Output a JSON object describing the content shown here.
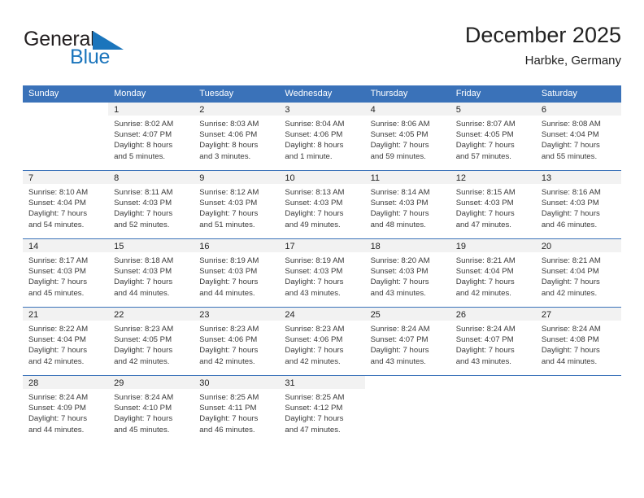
{
  "brand": {
    "word1": "General",
    "word2": "Blue",
    "triangle_icon": "blue-triangle-icon",
    "color_dark": "#231f20",
    "color_blue": "#1b75bc"
  },
  "header": {
    "title": "December 2025",
    "subtitle": "Harbke, Germany"
  },
  "theme": {
    "header_blue": "#3a72b9",
    "daynum_band": "#f2f2f2",
    "text": "#222222"
  },
  "weekdays": [
    "Sunday",
    "Monday",
    "Tuesday",
    "Wednesday",
    "Thursday",
    "Friday",
    "Saturday"
  ],
  "labels": {
    "sunrise": "Sunrise:",
    "sunset": "Sunset:",
    "daylight": "Daylight:"
  },
  "weeks": [
    [
      {
        "empty": true
      },
      {
        "day": "1",
        "l1": "Sunrise: 8:02 AM",
        "l2": "Sunset: 4:07 PM",
        "l3": "Daylight: 8 hours",
        "l4": "and 5 minutes."
      },
      {
        "day": "2",
        "l1": "Sunrise: 8:03 AM",
        "l2": "Sunset: 4:06 PM",
        "l3": "Daylight: 8 hours",
        "l4": "and 3 minutes."
      },
      {
        "day": "3",
        "l1": "Sunrise: 8:04 AM",
        "l2": "Sunset: 4:06 PM",
        "l3": "Daylight: 8 hours",
        "l4": "and 1 minute."
      },
      {
        "day": "4",
        "l1": "Sunrise: 8:06 AM",
        "l2": "Sunset: 4:05 PM",
        "l3": "Daylight: 7 hours",
        "l4": "and 59 minutes."
      },
      {
        "day": "5",
        "l1": "Sunrise: 8:07 AM",
        "l2": "Sunset: 4:05 PM",
        "l3": "Daylight: 7 hours",
        "l4": "and 57 minutes."
      },
      {
        "day": "6",
        "l1": "Sunrise: 8:08 AM",
        "l2": "Sunset: 4:04 PM",
        "l3": "Daylight: 7 hours",
        "l4": "and 55 minutes."
      }
    ],
    [
      {
        "day": "7",
        "l1": "Sunrise: 8:10 AM",
        "l2": "Sunset: 4:04 PM",
        "l3": "Daylight: 7 hours",
        "l4": "and 54 minutes."
      },
      {
        "day": "8",
        "l1": "Sunrise: 8:11 AM",
        "l2": "Sunset: 4:03 PM",
        "l3": "Daylight: 7 hours",
        "l4": "and 52 minutes."
      },
      {
        "day": "9",
        "l1": "Sunrise: 8:12 AM",
        "l2": "Sunset: 4:03 PM",
        "l3": "Daylight: 7 hours",
        "l4": "and 51 minutes."
      },
      {
        "day": "10",
        "l1": "Sunrise: 8:13 AM",
        "l2": "Sunset: 4:03 PM",
        "l3": "Daylight: 7 hours",
        "l4": "and 49 minutes."
      },
      {
        "day": "11",
        "l1": "Sunrise: 8:14 AM",
        "l2": "Sunset: 4:03 PM",
        "l3": "Daylight: 7 hours",
        "l4": "and 48 minutes."
      },
      {
        "day": "12",
        "l1": "Sunrise: 8:15 AM",
        "l2": "Sunset: 4:03 PM",
        "l3": "Daylight: 7 hours",
        "l4": "and 47 minutes."
      },
      {
        "day": "13",
        "l1": "Sunrise: 8:16 AM",
        "l2": "Sunset: 4:03 PM",
        "l3": "Daylight: 7 hours",
        "l4": "and 46 minutes."
      }
    ],
    [
      {
        "day": "14",
        "l1": "Sunrise: 8:17 AM",
        "l2": "Sunset: 4:03 PM",
        "l3": "Daylight: 7 hours",
        "l4": "and 45 minutes."
      },
      {
        "day": "15",
        "l1": "Sunrise: 8:18 AM",
        "l2": "Sunset: 4:03 PM",
        "l3": "Daylight: 7 hours",
        "l4": "and 44 minutes."
      },
      {
        "day": "16",
        "l1": "Sunrise: 8:19 AM",
        "l2": "Sunset: 4:03 PM",
        "l3": "Daylight: 7 hours",
        "l4": "and 44 minutes."
      },
      {
        "day": "17",
        "l1": "Sunrise: 8:19 AM",
        "l2": "Sunset: 4:03 PM",
        "l3": "Daylight: 7 hours",
        "l4": "and 43 minutes."
      },
      {
        "day": "18",
        "l1": "Sunrise: 8:20 AM",
        "l2": "Sunset: 4:03 PM",
        "l3": "Daylight: 7 hours",
        "l4": "and 43 minutes."
      },
      {
        "day": "19",
        "l1": "Sunrise: 8:21 AM",
        "l2": "Sunset: 4:04 PM",
        "l3": "Daylight: 7 hours",
        "l4": "and 42 minutes."
      },
      {
        "day": "20",
        "l1": "Sunrise: 8:21 AM",
        "l2": "Sunset: 4:04 PM",
        "l3": "Daylight: 7 hours",
        "l4": "and 42 minutes."
      }
    ],
    [
      {
        "day": "21",
        "l1": "Sunrise: 8:22 AM",
        "l2": "Sunset: 4:04 PM",
        "l3": "Daylight: 7 hours",
        "l4": "and 42 minutes."
      },
      {
        "day": "22",
        "l1": "Sunrise: 8:23 AM",
        "l2": "Sunset: 4:05 PM",
        "l3": "Daylight: 7 hours",
        "l4": "and 42 minutes."
      },
      {
        "day": "23",
        "l1": "Sunrise: 8:23 AM",
        "l2": "Sunset: 4:06 PM",
        "l3": "Daylight: 7 hours",
        "l4": "and 42 minutes."
      },
      {
        "day": "24",
        "l1": "Sunrise: 8:23 AM",
        "l2": "Sunset: 4:06 PM",
        "l3": "Daylight: 7 hours",
        "l4": "and 42 minutes."
      },
      {
        "day": "25",
        "l1": "Sunrise: 8:24 AM",
        "l2": "Sunset: 4:07 PM",
        "l3": "Daylight: 7 hours",
        "l4": "and 43 minutes."
      },
      {
        "day": "26",
        "l1": "Sunrise: 8:24 AM",
        "l2": "Sunset: 4:07 PM",
        "l3": "Daylight: 7 hours",
        "l4": "and 43 minutes."
      },
      {
        "day": "27",
        "l1": "Sunrise: 8:24 AM",
        "l2": "Sunset: 4:08 PM",
        "l3": "Daylight: 7 hours",
        "l4": "and 44 minutes."
      }
    ],
    [
      {
        "day": "28",
        "l1": "Sunrise: 8:24 AM",
        "l2": "Sunset: 4:09 PM",
        "l3": "Daylight: 7 hours",
        "l4": "and 44 minutes."
      },
      {
        "day": "29",
        "l1": "Sunrise: 8:24 AM",
        "l2": "Sunset: 4:10 PM",
        "l3": "Daylight: 7 hours",
        "l4": "and 45 minutes."
      },
      {
        "day": "30",
        "l1": "Sunrise: 8:25 AM",
        "l2": "Sunset: 4:11 PM",
        "l3": "Daylight: 7 hours",
        "l4": "and 46 minutes."
      },
      {
        "day": "31",
        "l1": "Sunrise: 8:25 AM",
        "l2": "Sunset: 4:12 PM",
        "l3": "Daylight: 7 hours",
        "l4": "and 47 minutes."
      },
      {
        "empty": true
      },
      {
        "empty": true
      },
      {
        "empty": true
      }
    ]
  ]
}
